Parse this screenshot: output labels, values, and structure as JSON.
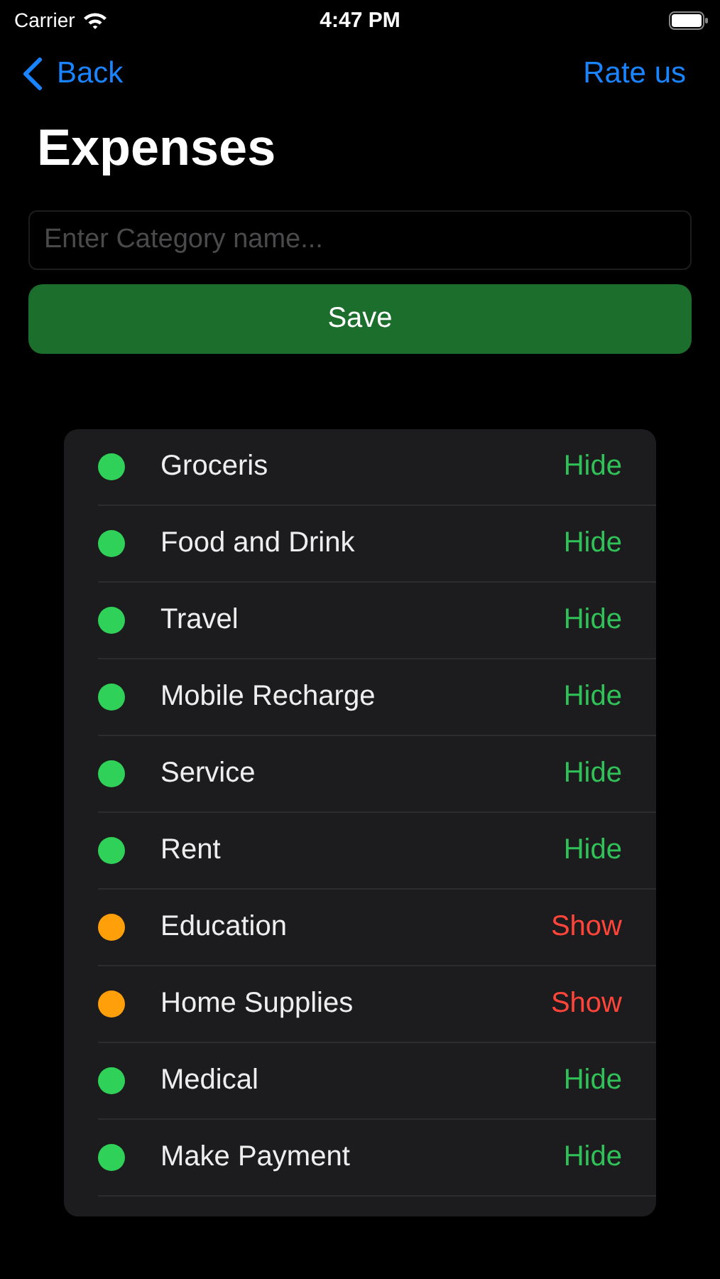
{
  "status_bar": {
    "carrier": "Carrier",
    "time": "4:47 PM"
  },
  "nav": {
    "back": "Back",
    "action": "Rate us"
  },
  "title": "Expenses",
  "search": {
    "placeholder": "Enter Category name..."
  },
  "save_button": "Save",
  "categories": [
    {
      "name": "Groceris",
      "hidden": false,
      "action": "Hide"
    },
    {
      "name": "Food and Drink",
      "hidden": false,
      "action": "Hide"
    },
    {
      "name": "Travel",
      "hidden": false,
      "action": "Hide"
    },
    {
      "name": "Mobile Recharge",
      "hidden": false,
      "action": "Hide"
    },
    {
      "name": "Service",
      "hidden": false,
      "action": "Hide"
    },
    {
      "name": "Rent",
      "hidden": false,
      "action": "Hide"
    },
    {
      "name": "Education",
      "hidden": true,
      "action": "Show"
    },
    {
      "name": "Home Supplies",
      "hidden": true,
      "action": "Show"
    },
    {
      "name": "Medical",
      "hidden": false,
      "action": "Hide"
    },
    {
      "name": "Make Payment",
      "hidden": false,
      "action": "Hide"
    }
  ]
}
